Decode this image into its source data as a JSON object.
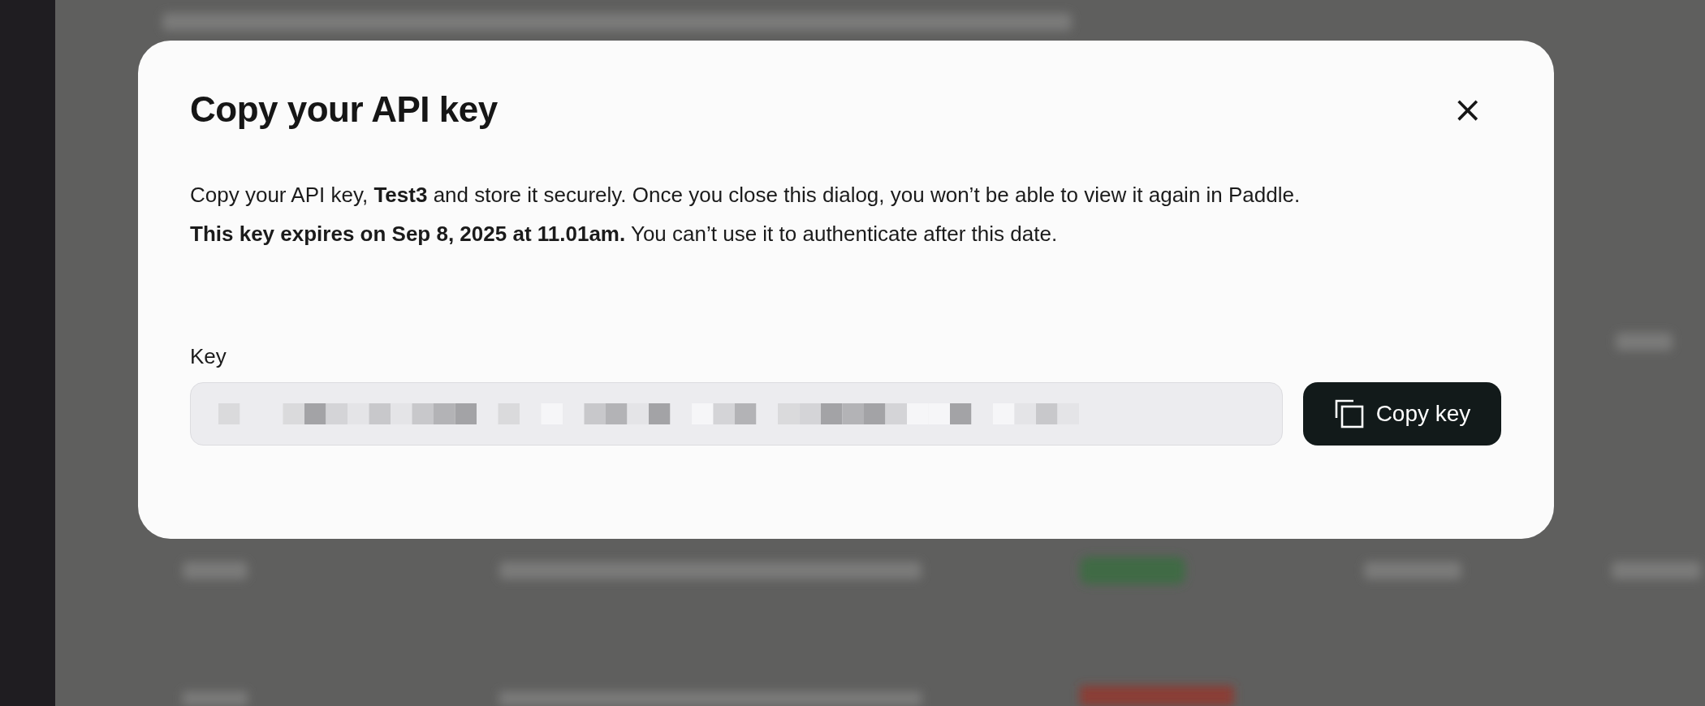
{
  "dialog": {
    "title": "Copy your API key",
    "close_icon": "×",
    "paragraphs": [
      "Copy your API key, **Test3** and store it securely. Once you close this dialog, you won’t be able to view it again in Paddle.",
      "**This key expires on Sep 8, 2025 at 11.01am.** You can’t use it to authenticate after this date."
    ],
    "field": {
      "label": "Key"
    },
    "copy_button": {
      "label": "Copy key"
    }
  }
}
